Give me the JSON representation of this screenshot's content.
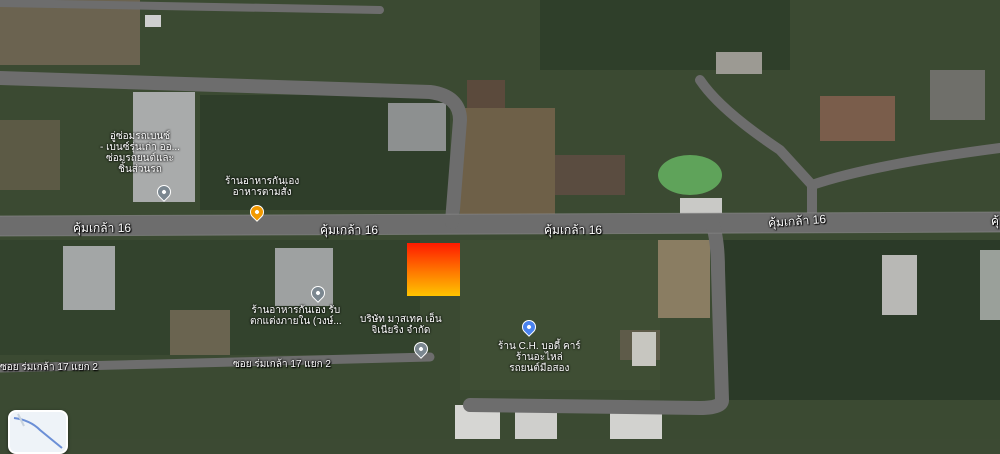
{
  "map": {
    "road_name_main": "คุ้มเกล้า 16",
    "road_name_main_partial": "คุ้",
    "soi_label": "ซอย ร่มเกล้า 17 แยก 2",
    "colors": {
      "road": "#6d6d6d",
      "highlight_top": "#ff1a00",
      "highlight_bottom": "#ffc400",
      "pin_gray": "#7b8790",
      "pin_orange": "#f29900",
      "pin_blue": "#4a83f0"
    }
  },
  "pois": {
    "repair_shop": {
      "lines": [
        "อู่ซ่อมรถเบนซ์",
        "- เบนซ์รุ่นเก่า ออ...",
        "ซ่อมรถยนต์และ",
        "ชิ้นส่วนรถ"
      ],
      "icon": "map-pin-gray-icon"
    },
    "kan_eng_food": {
      "lines": [
        "ร้านอาหารกันเอง",
        "อาหารตามสั่ง"
      ],
      "icon": "restaurant-pin-icon"
    },
    "kan_eng_food_2": {
      "lines": [
        "ร้านอาหารกันเอง รับ",
        "ตกแต่งภายใน (วงษ์..."
      ],
      "icon": "map-pin-gray-icon"
    },
    "company": {
      "lines": [
        "บริษัท มาสเทค เอ็น",
        "จิเนียริ่ง จำกัด"
      ],
      "icon": "map-pin-gray-icon"
    },
    "ch_body_car": {
      "lines": [
        "ร้าน C.H. บอดี้ คาร์",
        "ร้านอะไหล่",
        "รถยนต์มือสอง"
      ],
      "icon": "car-repair-pin-icon"
    }
  }
}
